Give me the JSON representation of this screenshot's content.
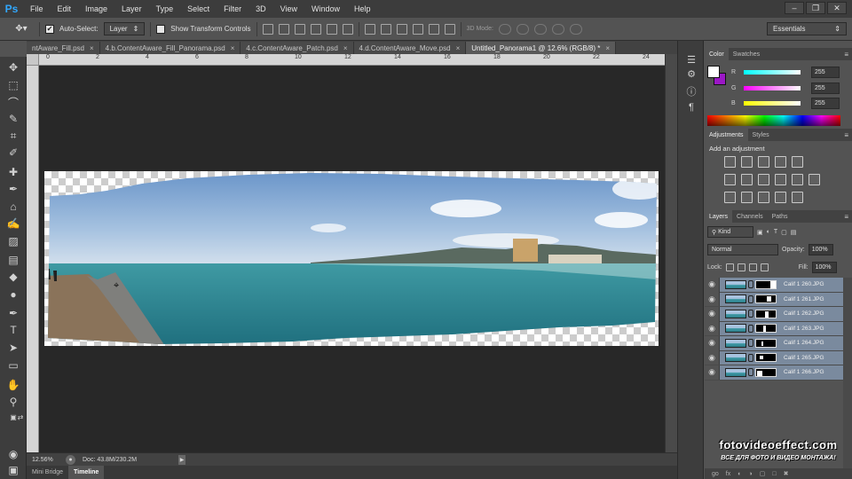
{
  "app": {
    "logo": "Ps",
    "menu": [
      "File",
      "Edit",
      "Image",
      "Layer",
      "Type",
      "Select",
      "Filter",
      "3D",
      "View",
      "Window",
      "Help"
    ],
    "window_controls": [
      "–",
      "❐",
      "✕"
    ]
  },
  "options_bar": {
    "auto_select_checked": true,
    "auto_select_label": "Auto-Select:",
    "auto_select_target": "Layer",
    "transform_label": "Show Transform Controls",
    "mode_label": "3D Mode:",
    "workspace": "Essentials"
  },
  "tabs": [
    {
      "label": "ntAware_Fill.psd",
      "active": false
    },
    {
      "label": "4.b.ContentAware_Fill_Panorama.psd",
      "active": false
    },
    {
      "label": "4.c.ContentAware_Patch.psd",
      "active": false
    },
    {
      "label": "4.d.ContentAware_Move.psd",
      "active": false
    },
    {
      "label": "Untitled_Panorama1 @ 12.6% (RGB/8) *",
      "active": true
    }
  ],
  "tab_close": "×",
  "ruler_ticks": [
    "0",
    "2",
    "4",
    "6",
    "8",
    "10",
    "12",
    "14",
    "16",
    "18",
    "20",
    "22",
    "24"
  ],
  "status": {
    "zoom": "12.56%",
    "doc": "Doc: 43.8M/230.2M"
  },
  "bottom_tabs": [
    {
      "label": "Mini Bridge",
      "active": false
    },
    {
      "label": "Timeline",
      "active": true
    }
  ],
  "color_panel": {
    "tabs": [
      {
        "label": "Color",
        "active": true
      },
      {
        "label": "Swatches",
        "active": false
      }
    ],
    "channels": [
      {
        "label": "R",
        "value": "255",
        "gradient": "#00ffff"
      },
      {
        "label": "G",
        "value": "255",
        "gradient": "#ff00ff"
      },
      {
        "label": "B",
        "value": "255",
        "gradient": "#ffff00"
      }
    ],
    "foreground": "#ffffff",
    "background": "#9b17c6"
  },
  "adjustments_panel": {
    "tabs": [
      {
        "label": "Adjustments",
        "active": true
      },
      {
        "label": "Styles",
        "active": false
      }
    ],
    "title": "Add an adjustment"
  },
  "layers_panel": {
    "tabs": [
      {
        "label": "Layers",
        "active": true
      },
      {
        "label": "Channels",
        "active": false
      },
      {
        "label": "Paths",
        "active": false
      }
    ],
    "filter_kind": "Kind",
    "blend_mode": "Normal",
    "opacity_label": "Opacity:",
    "opacity": "100%",
    "lock_label": "Lock:",
    "fill_label": "Fill:",
    "fill": "100%",
    "layers": [
      {
        "name": "Calif 1 260.JPG"
      },
      {
        "name": "Calif 1 261.JPG"
      },
      {
        "name": "Calif 1 262.JPG"
      },
      {
        "name": "Calif 1 263.JPG"
      },
      {
        "name": "Calif 1 264.JPG"
      },
      {
        "name": "Calif 1 265.JPG"
      },
      {
        "name": "Calif 1 266.JPG"
      }
    ],
    "bottom_icons": [
      "go",
      "fx",
      "◐",
      "◑",
      "▢",
      "□",
      "✖"
    ]
  },
  "watermark": {
    "title": "fotovideoeffect.com",
    "subtitle": "ВСЕ ДЛЯ ФОТО И ВИДЕО МОНТАЖА!"
  }
}
